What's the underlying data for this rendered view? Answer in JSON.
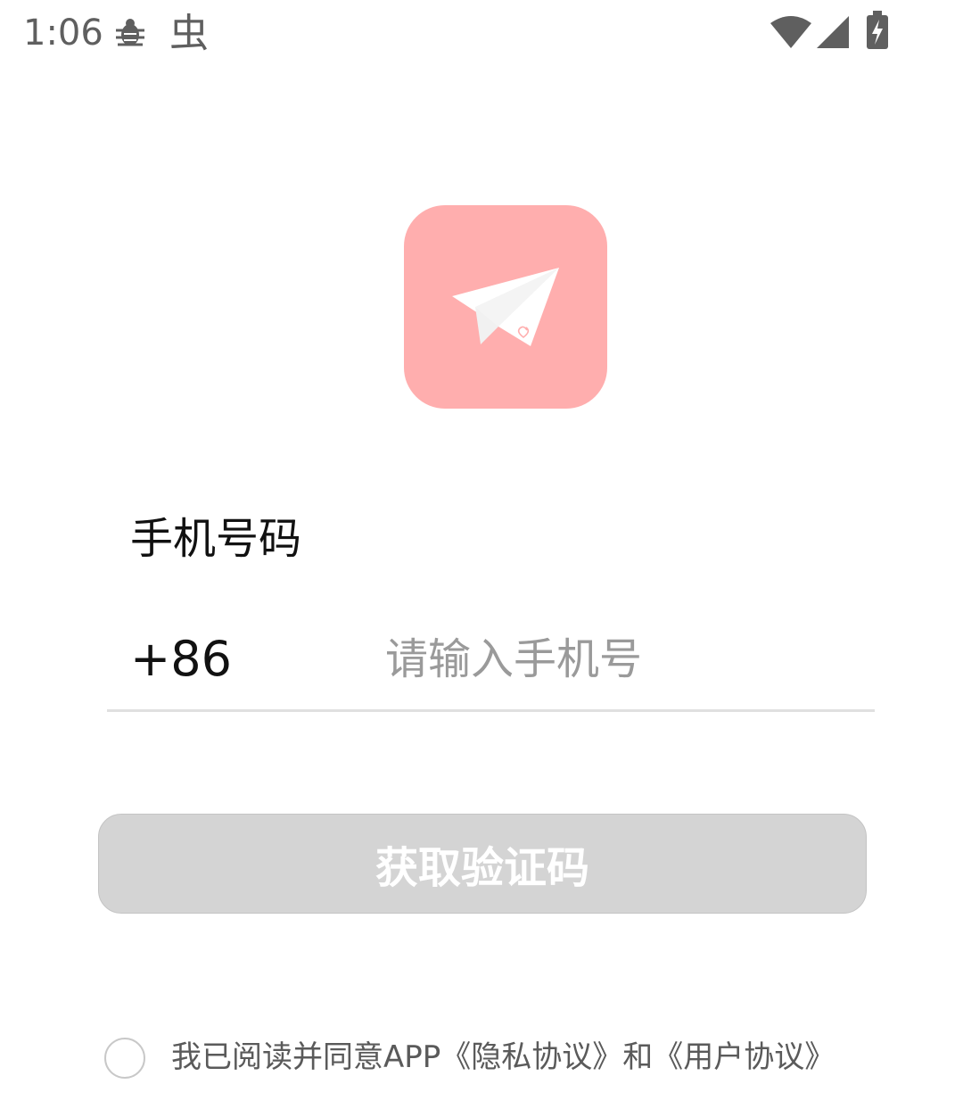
{
  "status_bar": {
    "time": "1:06",
    "icons": [
      "bug-icon",
      "cn-app-icon",
      "wifi-icon",
      "signal-icon",
      "battery-charging-icon"
    ],
    "cn_icon_glyph": "虫"
  },
  "logo": {
    "icon": "paper-plane-icon",
    "background_color": "#ffaeae"
  },
  "form": {
    "phone_label": "手机号码",
    "country_code": "+86",
    "phone_placeholder": "请输入手机号",
    "phone_value": ""
  },
  "button": {
    "label": "获取验证码",
    "color": "#d4d4d4"
  },
  "agreement": {
    "prefix": "我已阅读并同意APP",
    "privacy_link": "《隐私协议》",
    "connector": "和",
    "user_link": "《用户协议》"
  }
}
